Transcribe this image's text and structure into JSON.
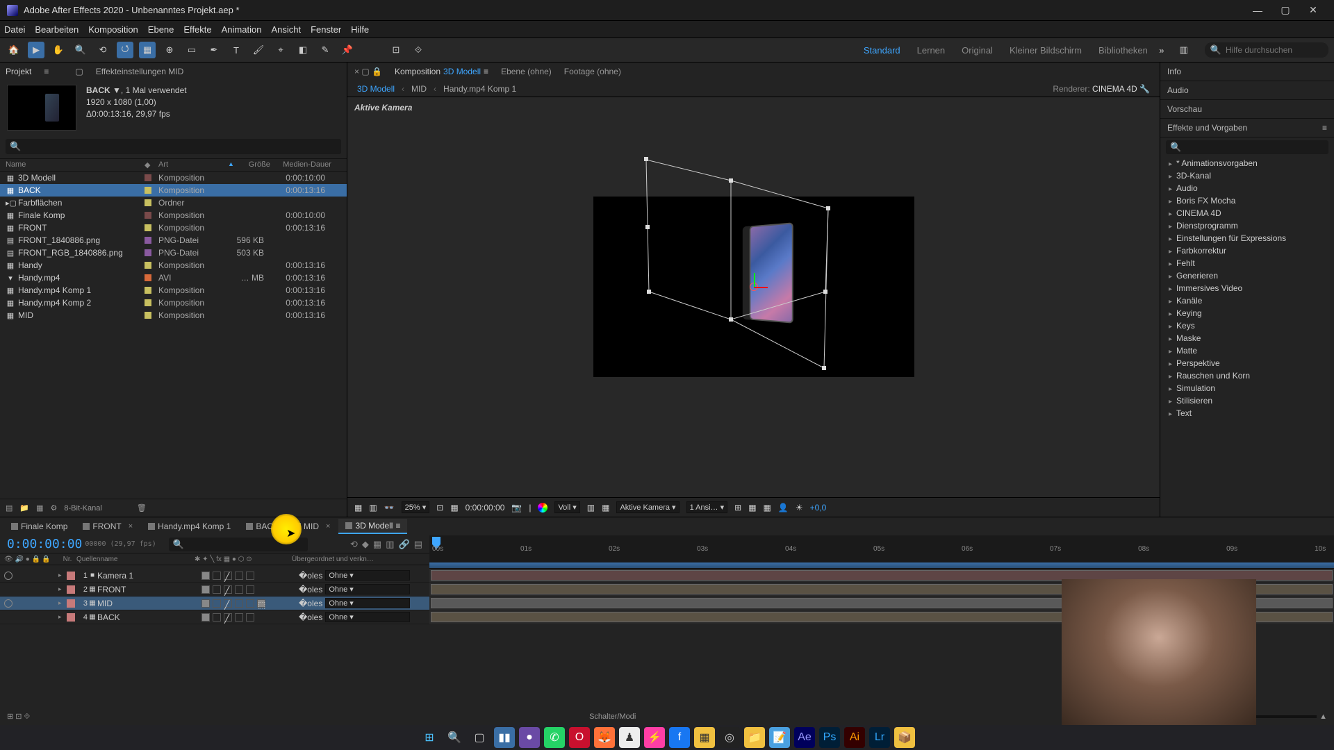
{
  "window": {
    "title": "Adobe After Effects 2020 - Unbenanntes Projekt.aep *"
  },
  "menu": [
    "Datei",
    "Bearbeiten",
    "Komposition",
    "Ebene",
    "Effekte",
    "Animation",
    "Ansicht",
    "Fenster",
    "Hilfe"
  ],
  "workspaces": {
    "items": [
      "Standard",
      "Lernen",
      "Original",
      "Kleiner Bildschirm",
      "Bibliotheken"
    ],
    "active": "Standard"
  },
  "help_search_placeholder": "Hilfe durchsuchen",
  "project": {
    "panel_title": "Projekt",
    "effect_settings_label": "Effekteinstellungen MID",
    "selected_name": "BACK",
    "selected_usage": ", 1 Mal verwendet",
    "selected_res": "1920 x 1080 (1,00)",
    "selected_dur": "Δ0:00:13:16, 29,97 fps",
    "columns": {
      "name": "Name",
      "art": "Art",
      "size": "Größe",
      "dur": "Medien-Dauer"
    },
    "items": [
      {
        "name": "3D Modell",
        "kind": "Komposition",
        "size": "",
        "dur": "0:00:10:00",
        "color": "#7a4a4a",
        "icon": "▦"
      },
      {
        "name": "BACK",
        "kind": "Komposition",
        "size": "",
        "dur": "0:00:13:16",
        "color": "#c8c060",
        "icon": "▦",
        "selected": true
      },
      {
        "name": "Farbflächen",
        "kind": "Ordner",
        "size": "",
        "dur": "",
        "color": "#c8c060",
        "icon": "▸▢"
      },
      {
        "name": "Finale Komp",
        "kind": "Komposition",
        "size": "",
        "dur": "0:00:10:00",
        "color": "#7a4a4a",
        "icon": "▦"
      },
      {
        "name": "FRONT",
        "kind": "Komposition",
        "size": "",
        "dur": "0:00:13:16",
        "color": "#c8c060",
        "icon": "▦"
      },
      {
        "name": "FRONT_1840886.png",
        "kind": "PNG-Datei",
        "size": "596 KB",
        "dur": "",
        "color": "#8a5aa0",
        "icon": "▤"
      },
      {
        "name": "FRONT_RGB_1840886.png",
        "kind": "PNG-Datei",
        "size": "503 KB",
        "dur": "",
        "color": "#8a5aa0",
        "icon": "▤"
      },
      {
        "name": "Handy",
        "kind": "Komposition",
        "size": "",
        "dur": "0:00:13:16",
        "color": "#c8c060",
        "icon": "▦"
      },
      {
        "name": "Handy.mp4",
        "kind": "AVI",
        "size": "… MB",
        "dur": "0:00:13:16",
        "color": "#d86a3a",
        "icon": "▾"
      },
      {
        "name": "Handy.mp4 Komp 1",
        "kind": "Komposition",
        "size": "",
        "dur": "0:00:13:16",
        "color": "#c8c060",
        "icon": "▦"
      },
      {
        "name": "Handy.mp4 Komp 2",
        "kind": "Komposition",
        "size": "",
        "dur": "0:00:13:16",
        "color": "#c8c060",
        "icon": "▦"
      },
      {
        "name": "MID",
        "kind": "Komposition",
        "size": "",
        "dur": "0:00:13:16",
        "color": "#c8c060",
        "icon": "▦"
      }
    ],
    "footer_bpc": "8-Bit-Kanal"
  },
  "comp": {
    "tabs_prefix": "Komposition",
    "tab_active": "3D Modell",
    "tab_ebene": "Ebene  (ohne)",
    "tab_footage": "Footage  (ohne)",
    "crumbs": [
      "3D Modell",
      "MID",
      "Handy.mp4 Komp 1"
    ],
    "renderer_label": "Renderer:",
    "renderer_value": "CINEMA 4D",
    "active_camera_label": "Aktive Kamera",
    "footer": {
      "zoom": "25%",
      "timecode": "0:00:00:00",
      "resolution": "Voll",
      "camera": "Aktive Kamera",
      "views": "1 Ansi…",
      "exposure": "+0,0"
    }
  },
  "right": {
    "info": "Info",
    "audio": "Audio",
    "vorschau": "Vorschau",
    "effects_title": "Effekte und Vorgaben",
    "categories": [
      "* Animationsvorgaben",
      "3D-Kanal",
      "Audio",
      "Boris FX Mocha",
      "CINEMA 4D",
      "Dienstprogramm",
      "Einstellungen für Expressions",
      "Farbkorrektur",
      "Fehlt",
      "Generieren",
      "Immersives Video",
      "Kanäle",
      "Keying",
      "Keys",
      "Maske",
      "Matte",
      "Perspektive",
      "Rauschen und Korn",
      "Simulation",
      "Stilisieren",
      "Text"
    ]
  },
  "timeline": {
    "tabs": [
      {
        "label": "Finale Komp"
      },
      {
        "label": "FRONT",
        "closable": true
      },
      {
        "label": "Handy.mp4 Komp 1"
      },
      {
        "label": "BACK"
      },
      {
        "label": "MID",
        "closable": true
      },
      {
        "label": "3D Modell",
        "active": true
      }
    ],
    "current_time": "0:00:00:00",
    "current_time_sub": "00000 (29,97 fps)",
    "columns": {
      "nr": "Nr.",
      "name": "Quellenname",
      "parent": "Übergeordnet und verkn…"
    },
    "ruler": [
      "00s",
      "01s",
      "02s",
      "03s",
      "04s",
      "05s",
      "06s",
      "07s",
      "08s",
      "09s",
      "10s"
    ],
    "parent_none": "Ohne",
    "layers": [
      {
        "nr": 1,
        "name": "Kamera 1",
        "color": "#c77a7a",
        "icon": "■",
        "track_color": "#c77a7a",
        "eye": true
      },
      {
        "nr": 2,
        "name": "FRONT",
        "color": "#c77a7a",
        "icon": "▦",
        "track_color": "#bba178"
      },
      {
        "nr": 3,
        "name": "MID",
        "color": "#c77a7a",
        "icon": "▦",
        "track_color": "#b8b8b8",
        "selected": true,
        "cube": true,
        "eye": true
      },
      {
        "nr": 4,
        "name": "BACK",
        "color": "#c77a7a",
        "icon": "▦",
        "track_color": "#bba178"
      }
    ],
    "footer_label": "Schalter/Modi"
  },
  "taskbar": [
    {
      "bg": "transparent",
      "glyph": "⊞",
      "color": "#4cc2ff"
    },
    {
      "bg": "transparent",
      "glyph": "🔍",
      "color": "#ccc"
    },
    {
      "bg": "transparent",
      "glyph": "▢",
      "color": "#ccc"
    },
    {
      "bg": "#3a6ea5",
      "glyph": "▮▮",
      "color": "#fff"
    },
    {
      "bg": "#6a4aa5",
      "glyph": "●",
      "color": "#fff"
    },
    {
      "bg": "#25d366",
      "glyph": "✆",
      "color": "#fff"
    },
    {
      "bg": "#c8102e",
      "glyph": "O",
      "color": "#fff"
    },
    {
      "bg": "#ff7139",
      "glyph": "🦊",
      "color": "#fff"
    },
    {
      "bg": "#eee",
      "glyph": "♟",
      "color": "#333"
    },
    {
      "bg": "#ff3ea5",
      "glyph": "⚡",
      "color": "#fff"
    },
    {
      "bg": "#1877f2",
      "glyph": "f",
      "color": "#fff"
    },
    {
      "bg": "#f0c040",
      "glyph": "▦",
      "color": "#333"
    },
    {
      "bg": "#222",
      "glyph": "◎",
      "color": "#ccc"
    },
    {
      "bg": "#f0c040",
      "glyph": "📁",
      "color": "#333"
    },
    {
      "bg": "#4aa0e0",
      "glyph": "📝",
      "color": "#fff"
    },
    {
      "bg": "#00005b",
      "glyph": "Ae",
      "color": "#9999ff"
    },
    {
      "bg": "#001e36",
      "glyph": "Ps",
      "color": "#31a8ff"
    },
    {
      "bg": "#330000",
      "glyph": "Ai",
      "color": "#ff9a00"
    },
    {
      "bg": "#001e36",
      "glyph": "Lr",
      "color": "#31a8ff"
    },
    {
      "bg": "#f0c040",
      "glyph": "📦",
      "color": "#333"
    }
  ]
}
